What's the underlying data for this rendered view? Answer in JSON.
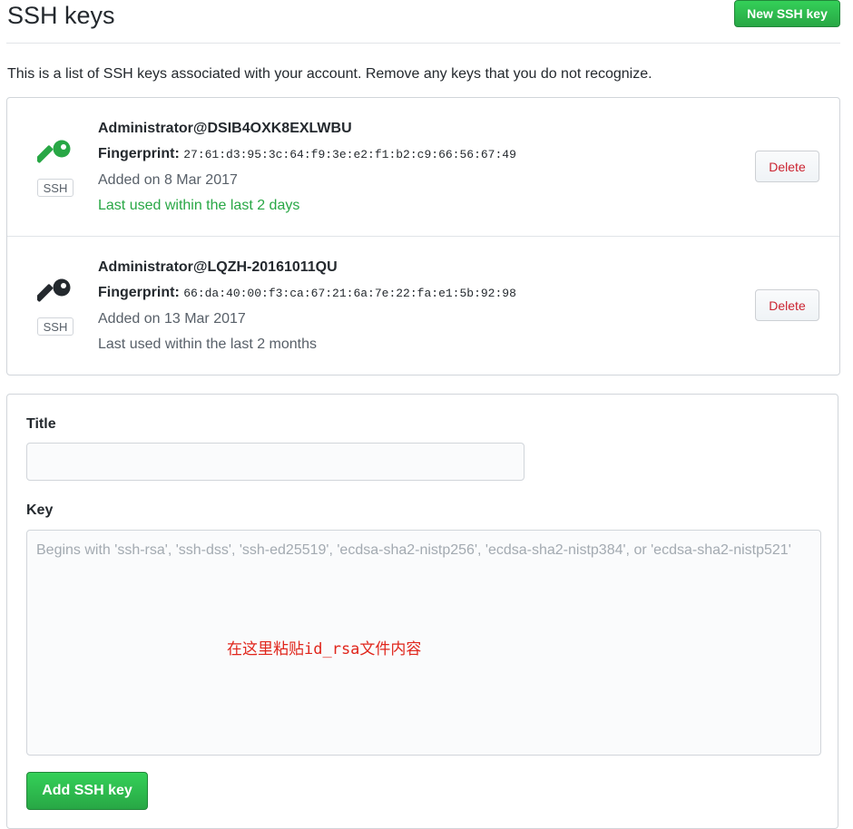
{
  "header": {
    "title": "SSH keys",
    "new_key_label": "New SSH key"
  },
  "intro": "This is a list of SSH keys associated with your account. Remove any keys that you do not recognize.",
  "keys": [
    {
      "name": "Administrator@DSIB4OXK8EXLWBU",
      "fingerprint_label": "Fingerprint:",
      "fingerprint": "27:61:d3:95:3c:64:f9:3e:e2:f1:b2:c9:66:56:67:49",
      "added": "Added on 8 Mar 2017",
      "last_used": "Last used within the last 2 days",
      "badge": "SSH",
      "icon": "key-icon",
      "icon_color": "#28a745",
      "delete_label": "Delete"
    },
    {
      "name": "Administrator@LQZH-20161011QU",
      "fingerprint_label": "Fingerprint:",
      "fingerprint": "66:da:40:00:f3:ca:67:21:6a:7e:22:fa:e1:5b:92:98",
      "added": "Added on 13 Mar 2017",
      "last_used": "Last used within the last 2 months",
      "badge": "SSH",
      "icon": "key-icon",
      "icon_color": "#24292e",
      "delete_label": "Delete"
    }
  ],
  "form": {
    "title_label": "Title",
    "title_value": "",
    "key_label": "Key",
    "key_placeholder": "Begins with 'ssh-rsa', 'ssh-dss', 'ssh-ed25519', 'ecdsa-sha2-nistp256', 'ecdsa-sha2-nistp384', or 'ecdsa-sha2-nistp521'",
    "annotation": "在这里粘贴id_rsa文件内容",
    "submit_label": "Add SSH key"
  }
}
